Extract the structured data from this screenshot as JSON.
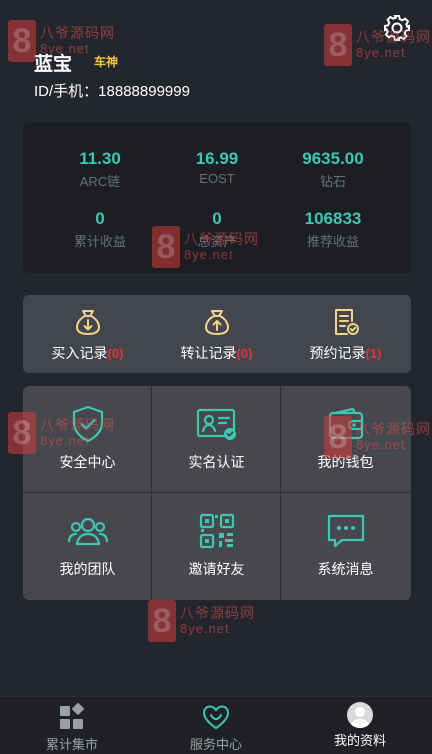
{
  "user": {
    "name": "蓝宝",
    "rank": "车神",
    "phone_label": "ID/手机：18888899999"
  },
  "stats": [
    {
      "value": "11.30",
      "label": "ARC链"
    },
    {
      "value": "16.99",
      "label": "EOST"
    },
    {
      "value": "9635.00",
      "label": "钻石"
    },
    {
      "value": "0",
      "label": "累计收益"
    },
    {
      "value": "0",
      "label": "总资产"
    },
    {
      "value": "106833",
      "label": "推荐收益"
    }
  ],
  "records": [
    {
      "label": "买入记录",
      "count": "(0)",
      "icon": "money-bag-down-icon"
    },
    {
      "label": "转让记录",
      "count": "(0)",
      "icon": "money-bag-up-icon"
    },
    {
      "label": "预约记录",
      "count": "(1)",
      "icon": "document-check-icon"
    }
  ],
  "menu": [
    {
      "label": "安全中心",
      "icon": "shield-check-icon"
    },
    {
      "label": "实名认证",
      "icon": "id-card-icon"
    },
    {
      "label": "我的钱包",
      "icon": "wallet-icon"
    },
    {
      "label": "我的团队",
      "icon": "team-icon"
    },
    {
      "label": "邀请好友",
      "icon": "qr-code-icon"
    },
    {
      "label": "系统消息",
      "icon": "message-icon"
    }
  ],
  "tabs": [
    {
      "label": "累计集市",
      "icon": "grid-icon"
    },
    {
      "label": "服务中心",
      "icon": "heart-icon"
    },
    {
      "label": "我的资料",
      "icon": "avatar-icon"
    }
  ],
  "watermark": {
    "line1": "八爷源码网",
    "line2": "8ye.net",
    "digit": "8"
  },
  "colors": {
    "background": "#24262d",
    "accent": "#3ec7b2",
    "rank": "#f5c63d",
    "count": "#e8323a",
    "icon_gold": "#f2d48a"
  }
}
